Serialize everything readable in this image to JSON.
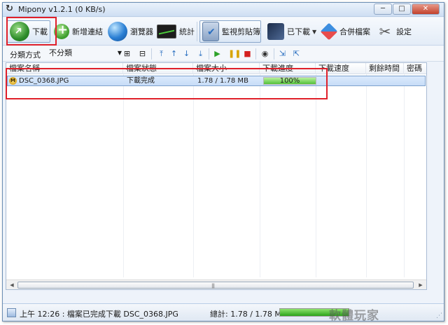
{
  "window": {
    "title": "Mipony v1.2.1 (0 KB/s)"
  },
  "caption": {
    "minimize": "─",
    "maximize": "□",
    "close": "✕"
  },
  "toolbar": {
    "download": "下載",
    "add_link": "新增連結",
    "browser": "瀏覽器",
    "stats": "統計",
    "clipboard": "監視剪貼簿",
    "downloaded": "已下載",
    "merge": "合併檔案",
    "settings": "設定"
  },
  "subbar": {
    "group_label": "分類方式",
    "group_value": "不分類"
  },
  "table": {
    "headers": [
      "檔案名稱",
      "檔案狀態",
      "檔案大小",
      "下載進度",
      "下載速度",
      "剩餘時間",
      "密碼"
    ],
    "rows": [
      {
        "name": "DSC_0368.JPG",
        "status": "下載完成",
        "size": "1.78 / 1.78 MB",
        "progress": 100,
        "progress_text": "100%",
        "speed": "",
        "remaining": "",
        "password": ""
      }
    ]
  },
  "statusbar": {
    "message": "上午 12:26 : 檔案已完成下載 DSC_0368.JPG",
    "total": "總計: 1.78 / 1.78 MB",
    "total_progress": 100,
    "watermark": "軟體玩家"
  }
}
